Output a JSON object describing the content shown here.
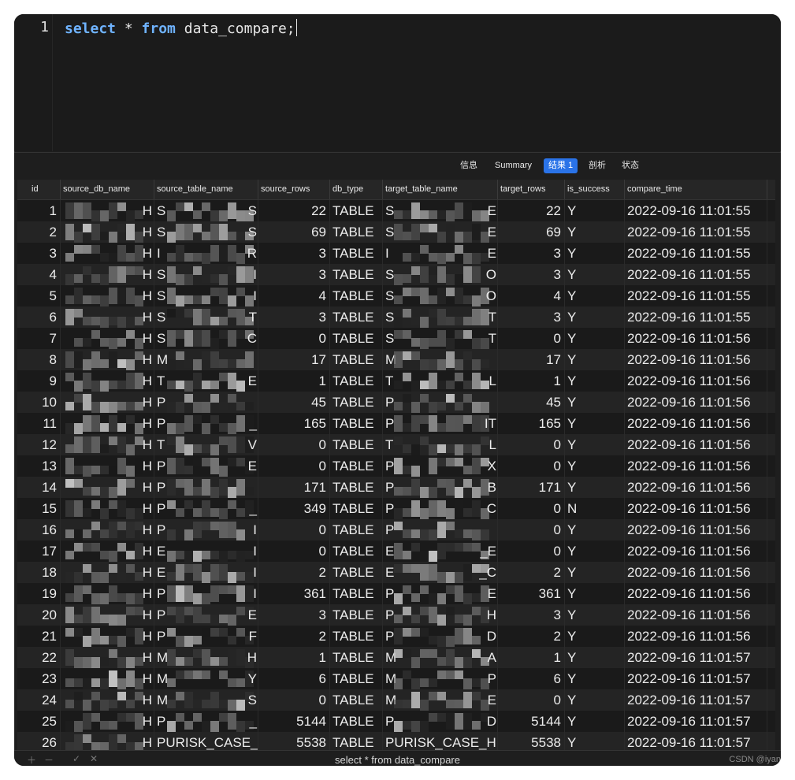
{
  "editor": {
    "line_number": "1",
    "tokens": {
      "kw_select": "select",
      "star": " * ",
      "kw_from": "from",
      "rest": " data_compare;"
    }
  },
  "result_tabs": [
    {
      "label": "信息",
      "active": false
    },
    {
      "label": "Summary",
      "active": false
    },
    {
      "label": "结果 1",
      "active": true
    },
    {
      "label": "剖析",
      "active": false
    },
    {
      "label": "状态",
      "active": false
    }
  ],
  "columns": [
    "id",
    "source_db_name",
    "source_table_name",
    "source_rows",
    "db_type",
    "target_table_name",
    "target_rows",
    "is_success",
    "compare_time"
  ],
  "rows": [
    {
      "id": "1",
      "db": "H",
      "src": "S",
      "src_end": "S",
      "source_rows": "22",
      "db_type": "TABLE",
      "tgt": "S",
      "tgt_end": "E",
      "target_rows": "22",
      "is_success": "Y",
      "compare_time": "2022-09-16 11:01:55"
    },
    {
      "id": "2",
      "db": "H",
      "src": "S",
      "src_end": "S",
      "source_rows": "69",
      "db_type": "TABLE",
      "tgt": "S",
      "tgt_end": "E",
      "target_rows": "69",
      "is_success": "Y",
      "compare_time": "2022-09-16 11:01:55"
    },
    {
      "id": "3",
      "db": "H",
      "src": "I",
      "src_end": "R",
      "source_rows": "3",
      "db_type": "TABLE",
      "tgt": "I",
      "tgt_end": "E",
      "target_rows": "3",
      "is_success": "Y",
      "compare_time": "2022-09-16 11:01:55"
    },
    {
      "id": "4",
      "db": "H",
      "src": "S",
      "src_end": "I",
      "source_rows": "3",
      "db_type": "TABLE",
      "tgt": "S",
      "tgt_end": "O",
      "target_rows": "3",
      "is_success": "Y",
      "compare_time": "2022-09-16 11:01:55"
    },
    {
      "id": "5",
      "db": "H",
      "src": "S",
      "src_end": "I",
      "source_rows": "4",
      "db_type": "TABLE",
      "tgt": "S",
      "tgt_end": "O",
      "target_rows": "4",
      "is_success": "Y",
      "compare_time": "2022-09-16 11:01:55"
    },
    {
      "id": "6",
      "db": "H",
      "src": "S",
      "src_end": "T",
      "source_rows": "3",
      "db_type": "TABLE",
      "tgt": "S",
      "tgt_end": "T",
      "target_rows": "3",
      "is_success": "Y",
      "compare_time": "2022-09-16 11:01:55"
    },
    {
      "id": "7",
      "db": "H",
      "src": "S",
      "src_end": "C",
      "source_rows": "0",
      "db_type": "TABLE",
      "tgt": "S",
      "tgt_end": "T",
      "target_rows": "0",
      "is_success": "Y",
      "compare_time": "2022-09-16 11:01:56"
    },
    {
      "id": "8",
      "db": "H",
      "src": "M",
      "src_end": "",
      "source_rows": "17",
      "db_type": "TABLE",
      "tgt": "M",
      "tgt_end": "",
      "target_rows": "17",
      "is_success": "Y",
      "compare_time": "2022-09-16 11:01:56"
    },
    {
      "id": "9",
      "db": "H",
      "src": "T",
      "src_end": "E",
      "source_rows": "1",
      "db_type": "TABLE",
      "tgt": "T",
      "tgt_end": "L",
      "target_rows": "1",
      "is_success": "Y",
      "compare_time": "2022-09-16 11:01:56"
    },
    {
      "id": "10",
      "db": "H",
      "src": "P",
      "src_end": "",
      "source_rows": "45",
      "db_type": "TABLE",
      "tgt": "P",
      "tgt_end": "",
      "target_rows": "45",
      "is_success": "Y",
      "compare_time": "2022-09-16 11:01:56"
    },
    {
      "id": "11",
      "db": "H",
      "src": "P",
      "src_end": "_",
      "source_rows": "165",
      "db_type": "TABLE",
      "tgt": "P",
      "tgt_end": "IT",
      "target_rows": "165",
      "is_success": "Y",
      "compare_time": "2022-09-16 11:01:56"
    },
    {
      "id": "12",
      "db": "H",
      "src": "T",
      "src_end": "V",
      "source_rows": "0",
      "db_type": "TABLE",
      "tgt": "T",
      "tgt_end": "L",
      "target_rows": "0",
      "is_success": "Y",
      "compare_time": "2022-09-16 11:01:56"
    },
    {
      "id": "13",
      "db": "H",
      "src": "P",
      "src_end": "E",
      "source_rows": "0",
      "db_type": "TABLE",
      "tgt": "P",
      "tgt_end": "X",
      "target_rows": "0",
      "is_success": "Y",
      "compare_time": "2022-09-16 11:01:56"
    },
    {
      "id": "14",
      "db": "H",
      "src": "P",
      "src_end": "",
      "source_rows": "171",
      "db_type": "TABLE",
      "tgt": "P",
      "tgt_end": "B",
      "target_rows": "171",
      "is_success": "Y",
      "compare_time": "2022-09-16 11:01:56"
    },
    {
      "id": "15",
      "db": "H",
      "src": "P",
      "src_end": "_",
      "source_rows": "349",
      "db_type": "TABLE",
      "tgt": "P",
      "tgt_end": "C",
      "target_rows": "0",
      "is_success": "N",
      "compare_time": "2022-09-16 11:01:56"
    },
    {
      "id": "16",
      "db": "H",
      "src": "P",
      "src_end": "I",
      "source_rows": "0",
      "db_type": "TABLE",
      "tgt": "P",
      "tgt_end": "",
      "target_rows": "0",
      "is_success": "Y",
      "compare_time": "2022-09-16 11:01:56"
    },
    {
      "id": "17",
      "db": "H",
      "src": "E",
      "src_end": "I",
      "source_rows": "0",
      "db_type": "TABLE",
      "tgt": "E",
      "tgt_end": "_E",
      "target_rows": "0",
      "is_success": "Y",
      "compare_time": "2022-09-16 11:01:56"
    },
    {
      "id": "18",
      "db": "H",
      "src": "E",
      "src_end": "I",
      "source_rows": "2",
      "db_type": "TABLE",
      "tgt": "E",
      "tgt_end": "_C",
      "target_rows": "2",
      "is_success": "Y",
      "compare_time": "2022-09-16 11:01:56"
    },
    {
      "id": "19",
      "db": "H",
      "src": "P",
      "src_end": "I",
      "source_rows": "361",
      "db_type": "TABLE",
      "tgt": "P",
      "tgt_end": "E",
      "target_rows": "361",
      "is_success": "Y",
      "compare_time": "2022-09-16 11:01:56"
    },
    {
      "id": "20",
      "db": "H",
      "src": "P",
      "src_end": "E",
      "source_rows": "3",
      "db_type": "TABLE",
      "tgt": "P",
      "tgt_end": "H",
      "target_rows": "3",
      "is_success": "Y",
      "compare_time": "2022-09-16 11:01:56"
    },
    {
      "id": "21",
      "db": "H",
      "src": "P",
      "src_end": "F",
      "source_rows": "2",
      "db_type": "TABLE",
      "tgt": "P",
      "tgt_end": "D",
      "target_rows": "2",
      "is_success": "Y",
      "compare_time": "2022-09-16 11:01:56"
    },
    {
      "id": "22",
      "db": "H",
      "src": "M",
      "src_end": "H",
      "source_rows": "1",
      "db_type": "TABLE",
      "tgt": "M",
      "tgt_end": "A",
      "target_rows": "1",
      "is_success": "Y",
      "compare_time": "2022-09-16 11:01:57"
    },
    {
      "id": "23",
      "db": "H",
      "src": "M",
      "src_end": "Y",
      "source_rows": "6",
      "db_type": "TABLE",
      "tgt": "M",
      "tgt_end": "P",
      "target_rows": "6",
      "is_success": "Y",
      "compare_time": "2022-09-16 11:01:57"
    },
    {
      "id": "24",
      "db": "H",
      "src": "M",
      "src_end": "S",
      "source_rows": "0",
      "db_type": "TABLE",
      "tgt": "M",
      "tgt_end": "E",
      "target_rows": "0",
      "is_success": "Y",
      "compare_time": "2022-09-16 11:01:57"
    },
    {
      "id": "25",
      "db": "H",
      "src": "P",
      "src_end": "_",
      "source_rows": "5144",
      "db_type": "TABLE",
      "tgt": "P",
      "tgt_end": "D",
      "target_rows": "5144",
      "is_success": "Y",
      "compare_time": "2022-09-16 11:01:57"
    },
    {
      "id": "26",
      "db": "H",
      "src": "PURISK_CASE_",
      "src_end": "",
      "source_rows": "5538",
      "db_type": "TABLE",
      "tgt": "PURISK_CASE_H",
      "tgt_end": "",
      "target_rows": "5538",
      "is_success": "Y",
      "compare_time": "2022-09-16 11:01:57"
    }
  ],
  "status_bar": {
    "sql": "select * from data_compare",
    "watermark": "CSDN @iyan"
  },
  "colors": {
    "accent": "#2a73e8",
    "keyword": "#6fb3ff",
    "background": "#1e1e1e"
  }
}
